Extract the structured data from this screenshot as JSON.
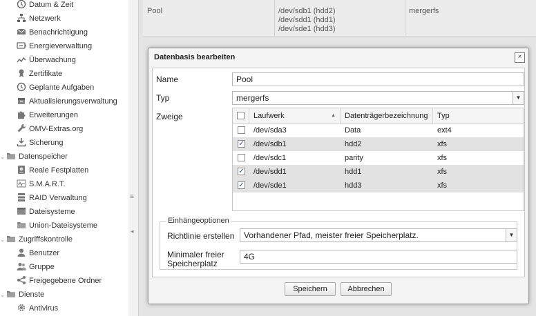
{
  "sidebar": {
    "items": [
      {
        "label": "Datum & Zeit",
        "icon": "clock-icon",
        "level": 1
      },
      {
        "label": "Netzwerk",
        "icon": "network-icon",
        "level": 1
      },
      {
        "label": "Benachrichtigung",
        "icon": "mail-icon",
        "level": 1
      },
      {
        "label": "Energieverwaltung",
        "icon": "power-icon",
        "level": 1
      },
      {
        "label": "Überwachung",
        "icon": "chart-icon",
        "level": 1
      },
      {
        "label": "Zertifikate",
        "icon": "certificate-icon",
        "level": 1
      },
      {
        "label": "Geplante Aufgaben",
        "icon": "clock-icon",
        "level": 1
      },
      {
        "label": "Aktualisierungsverwaltung",
        "icon": "package-icon",
        "level": 1
      },
      {
        "label": "Erweiterungen",
        "icon": "puzzle-icon",
        "level": 1
      },
      {
        "label": "OMV-Extras.org",
        "icon": "wrench-icon",
        "level": 1
      },
      {
        "label": "Sicherung",
        "icon": "download-icon",
        "level": 1
      },
      {
        "label": "Datenspeicher",
        "icon": "folder-icon",
        "level": 0
      },
      {
        "label": "Reale Festplatten",
        "icon": "disk-icon",
        "level": 1
      },
      {
        "label": "S.M.A.R.T.",
        "icon": "smart-icon",
        "level": 1
      },
      {
        "label": "RAID Verwaltung",
        "icon": "raid-icon",
        "level": 1
      },
      {
        "label": "Dateisysteme",
        "icon": "filesystem-icon",
        "level": 1
      },
      {
        "label": "Union-Dateisysteme",
        "icon": "folder-icon",
        "level": 1
      },
      {
        "label": "Zugriffskontrolle",
        "icon": "folder-icon",
        "level": 0
      },
      {
        "label": "Benutzer",
        "icon": "user-icon",
        "level": 1
      },
      {
        "label": "Gruppe",
        "icon": "group-icon",
        "level": 1
      },
      {
        "label": "Freigegebene Ordner",
        "icon": "share-icon",
        "level": 1
      },
      {
        "label": "Dienste",
        "icon": "folder-icon",
        "level": 0
      },
      {
        "label": "Antivirus",
        "icon": "gear-icon",
        "level": 1
      }
    ]
  },
  "background_row": {
    "name": "Pool",
    "branches": "/dev/sdb1 (hdd2)\n/dev/sdd1 (hdd1)\n/dev/sde1 (hdd3)",
    "type": "mergerfs"
  },
  "dialog": {
    "title": "Datenbasis bearbeiten",
    "close_label": "×",
    "name_label": "Name",
    "name_value": "Pool",
    "type_label": "Typ",
    "type_value": "mergerfs",
    "branches_label": "Zweige",
    "grid": {
      "columns": [
        "Laufwerk",
        "Datenträgerbezeichnung",
        "Typ"
      ],
      "sort_indicator": "▲",
      "rows": [
        {
          "device": "/dev/sda3",
          "label": "Data",
          "type": "ext4",
          "checked": false
        },
        {
          "device": "/dev/sdb1",
          "label": "hdd2",
          "type": "xfs",
          "checked": true
        },
        {
          "device": "/dev/sdc1",
          "label": "parity",
          "type": "xfs",
          "checked": false
        },
        {
          "device": "/dev/sdd1",
          "label": "hdd1",
          "type": "xfs",
          "checked": true
        },
        {
          "device": "/dev/sde1",
          "label": "hdd3",
          "type": "xfs",
          "checked": true
        }
      ]
    },
    "mount_options": {
      "legend": "Einhängeoptionen",
      "policy_label": "Richtlinie erstellen",
      "policy_value": "Vorhandener Pfad, meister freier Speicherplatz.",
      "minfree_label_line1": "Minimaler freier",
      "minfree_label_line2": "Speicherplatz",
      "minfree_value": "4G"
    },
    "save_label": "Speichern",
    "cancel_label": "Abbrechen"
  },
  "colors": {
    "selected_row": "#e2e2e2",
    "check_color": "#2a4c8a"
  }
}
